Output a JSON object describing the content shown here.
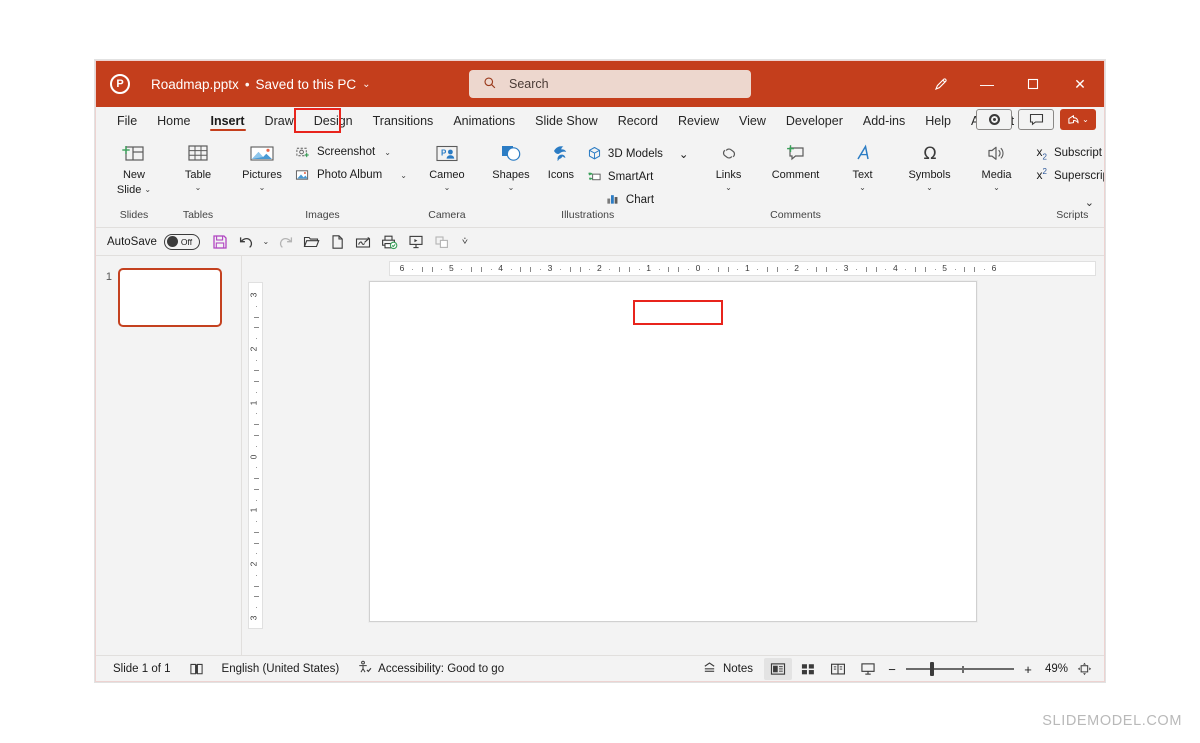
{
  "titlebar": {
    "logo": "powerpoint-logo-icon",
    "document_name": "Roadmap.pptx",
    "separator": "•",
    "save_state": "Saved to this PC",
    "dropdown_caret": "⌄",
    "search_placeholder": "Search",
    "search_icon": "search-icon",
    "ink_icon": "pen-ink-icon",
    "minimize": "—",
    "maximize": "☐",
    "close": "✕"
  },
  "tabs": [
    {
      "label": "File"
    },
    {
      "label": "Home"
    },
    {
      "label": "Insert",
      "active": true,
      "annotated": true
    },
    {
      "label": "Draw"
    },
    {
      "label": "Design"
    },
    {
      "label": "Transitions"
    },
    {
      "label": "Animations"
    },
    {
      "label": "Slide Show"
    },
    {
      "label": "Record"
    },
    {
      "label": "Review"
    },
    {
      "label": "View"
    },
    {
      "label": "Developer"
    },
    {
      "label": "Add-ins"
    },
    {
      "label": "Help"
    },
    {
      "label": "Acrobat"
    }
  ],
  "tabs_right": {
    "record_button": "record-icon",
    "comments_button": "comment-icon",
    "share_button": "Share"
  },
  "ribbon": {
    "groups": {
      "slides": {
        "label": "Slides",
        "new_slide": {
          "line1": "New",
          "line2": "Slide",
          "caret": "⌄"
        }
      },
      "tables": {
        "label": "Tables",
        "table": {
          "line1": "Table",
          "caret": "⌄"
        }
      },
      "images": {
        "label": "Images",
        "pictures": {
          "line1": "Pictures",
          "caret": "⌄"
        },
        "screenshot": {
          "label": "Screenshot",
          "caret": "⌄"
        },
        "photo_album": {
          "label": "Photo Album",
          "caret": "⌄"
        }
      },
      "camera": {
        "label": "Camera",
        "cameo": {
          "line1": "Cameo",
          "caret": "⌄"
        }
      },
      "illustrations": {
        "label": "Illustrations",
        "shapes": {
          "line1": "Shapes",
          "caret": "⌄"
        },
        "icons": {
          "line1": "Icons"
        },
        "models_3d": {
          "label": "3D Models",
          "caret": "⌄"
        },
        "smartart": {
          "label": "SmartArt",
          "annotated": true
        },
        "chart": {
          "label": "Chart"
        }
      },
      "links": {
        "links": {
          "line1": "Links",
          "caret": "⌄"
        }
      },
      "comments": {
        "label": "Comments",
        "comment": {
          "line1": "Comment"
        }
      },
      "text": {
        "text": {
          "line1": "Text",
          "caret": "⌄"
        }
      },
      "symbols": {
        "symbols": {
          "line1": "Symbols",
          "caret": "⌄"
        }
      },
      "media": {
        "media": {
          "line1": "Media",
          "caret": "⌄"
        }
      },
      "scripts": {
        "label": "Scripts",
        "subscript": {
          "glyph": "x",
          "script": "2",
          "label": "Subscript"
        },
        "superscript": {
          "glyph": "x",
          "script": "2",
          "label": "Superscript"
        }
      }
    },
    "collapse_caret": "⌄"
  },
  "quick_access": {
    "autosave_label": "AutoSave",
    "autosave_state": "Off",
    "icons": [
      "save-icon",
      "undo-icon",
      "undo-dropdown-caret",
      "redo-icon",
      "open-folder-icon",
      "new-file-icon",
      "signature-icon",
      "print-preview-icon",
      "start-slideshow-icon",
      "duplicate-icon",
      "qat-overflow-caret"
    ]
  },
  "thumbnails": {
    "slides": [
      {
        "number": "1",
        "selected": true
      }
    ]
  },
  "rulers": {
    "horizontal_ticks": [
      "6",
      "5",
      "4",
      "3",
      "2",
      "1",
      "0",
      "1",
      "2",
      "3",
      "4",
      "5",
      "6"
    ],
    "vertical_ticks": [
      "3",
      "2",
      "1",
      "0",
      "1",
      "2",
      "3"
    ]
  },
  "statusbar": {
    "slide_counter": "Slide 1 of 1",
    "notes_page_icon": "notes-page-icon",
    "language": "English (United States)",
    "accessibility_icon": "accessibility-icon",
    "accessibility": "Accessibility: Good to go",
    "notes_button": "Notes",
    "notes_icon": "notes-icon",
    "views": [
      {
        "name": "normal-view",
        "selected": true
      },
      {
        "name": "slide-sorter-view",
        "selected": false
      },
      {
        "name": "reading-view",
        "selected": false
      },
      {
        "name": "slide-show-view",
        "selected": false
      }
    ],
    "zoom_out": "−",
    "zoom_in": "+",
    "zoom_level": "49%",
    "fit_slide_icon": "fit-to-window-icon"
  },
  "watermark": "SLIDEMODEL.COM",
  "colors": {
    "brand": "#c43e1c",
    "annotation": "#e8241c",
    "ribbon_bg": "#f3f3f3",
    "accent_blue": "#2b579a",
    "save_purple": "#b146c2"
  }
}
